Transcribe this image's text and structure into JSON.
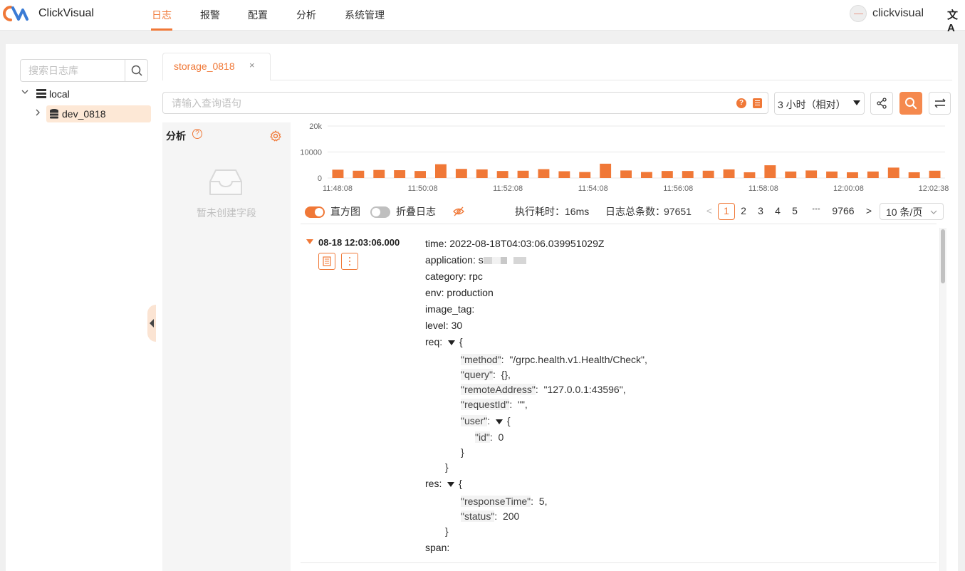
{
  "app": {
    "brand": "ClickVisual",
    "username": "clickvisual",
    "lang_icon": "文A"
  },
  "nav": [
    {
      "label": "日志",
      "active": true
    },
    {
      "label": "报警",
      "active": false
    },
    {
      "label": "配置",
      "active": false
    },
    {
      "label": "分析",
      "active": false
    },
    {
      "label": "系统管理",
      "active": false
    }
  ],
  "sidebar": {
    "search_placeholder": "搜索日志库",
    "tree": [
      {
        "label": "local",
        "expanded": true,
        "icon": "server-icon"
      },
      {
        "label": "dev_0818",
        "expanded": false,
        "selected": true,
        "icon": "database-icon"
      }
    ]
  },
  "tab": {
    "label": "storage_0818",
    "close": "×"
  },
  "query": {
    "placeholder": "请输入查询语句",
    "time_range": "3 小时（相对）",
    "help_glyph": "?"
  },
  "analysis": {
    "title": "分析",
    "help_glyph": "?",
    "empty_text": "暂未创建字段"
  },
  "chart_data": {
    "type": "bar",
    "y_ticks": [
      "20k",
      "10000",
      "0"
    ],
    "ylim": [
      0,
      20000
    ],
    "x_tick_labels": [
      "11:48:08",
      "11:50:08",
      "11:52:08",
      "11:54:08",
      "11:56:08",
      "11:58:08",
      "12:00:08",
      "12:02:38"
    ],
    "values": [
      3200,
      2800,
      3100,
      3000,
      2700,
      5300,
      3500,
      3300,
      2700,
      2800,
      3400,
      2600,
      2300,
      5500,
      2900,
      2300,
      2700,
      2700,
      2800,
      3300,
      2200,
      4900,
      2500,
      2900,
      2500,
      2200,
      2500,
      4000,
      2200,
      2800
    ],
    "bar_color": "#f07837",
    "grid": true
  },
  "toolbar": {
    "histogram_label": "直方图",
    "histogram_on": true,
    "fold_label": "折叠日志",
    "fold_on": false,
    "exec_label": "执行耗时：",
    "exec_value": "16ms",
    "total_label": "日志总条数：",
    "total_value": "97651",
    "pages": [
      "1",
      "2",
      "3",
      "4",
      "5"
    ],
    "ellipsis": "•••",
    "last_page": "9766",
    "page_size": "10 条/页",
    "prev": "<",
    "next": ">"
  },
  "log": {
    "timestamp": "08-18 12:03:06.000",
    "fields": [
      {
        "key": "time",
        "value": "2022-08-18T04:03:06.039951029Z"
      },
      {
        "key": "application",
        "value": "s"
      },
      {
        "key": "category",
        "value": "rpc"
      },
      {
        "key": "env",
        "value": "production"
      },
      {
        "key": "image_tag",
        "value": ""
      },
      {
        "key": "level",
        "value": "30"
      }
    ],
    "req_key": "req",
    "req_lines": [
      {
        "k": "\"method\"",
        "v": "\"/grpc.health.v1.Health/Check\","
      },
      {
        "k": "\"query\"",
        "v": "{},"
      },
      {
        "k": "\"remoteAddress\"",
        "v": "\"127.0.0.1:43596\","
      },
      {
        "k": "\"requestId\"",
        "v": "\"\","
      }
    ],
    "user_key": "\"user\"",
    "user_id_key": "\"id\"",
    "user_id_value": "0",
    "res_key": "res",
    "res_lines": [
      {
        "k": "\"responseTime\"",
        "v": "5,"
      },
      {
        "k": "\"status\"",
        "v": "200"
      }
    ],
    "span_key": "span",
    "open_brace": "{",
    "close_brace": "}"
  }
}
